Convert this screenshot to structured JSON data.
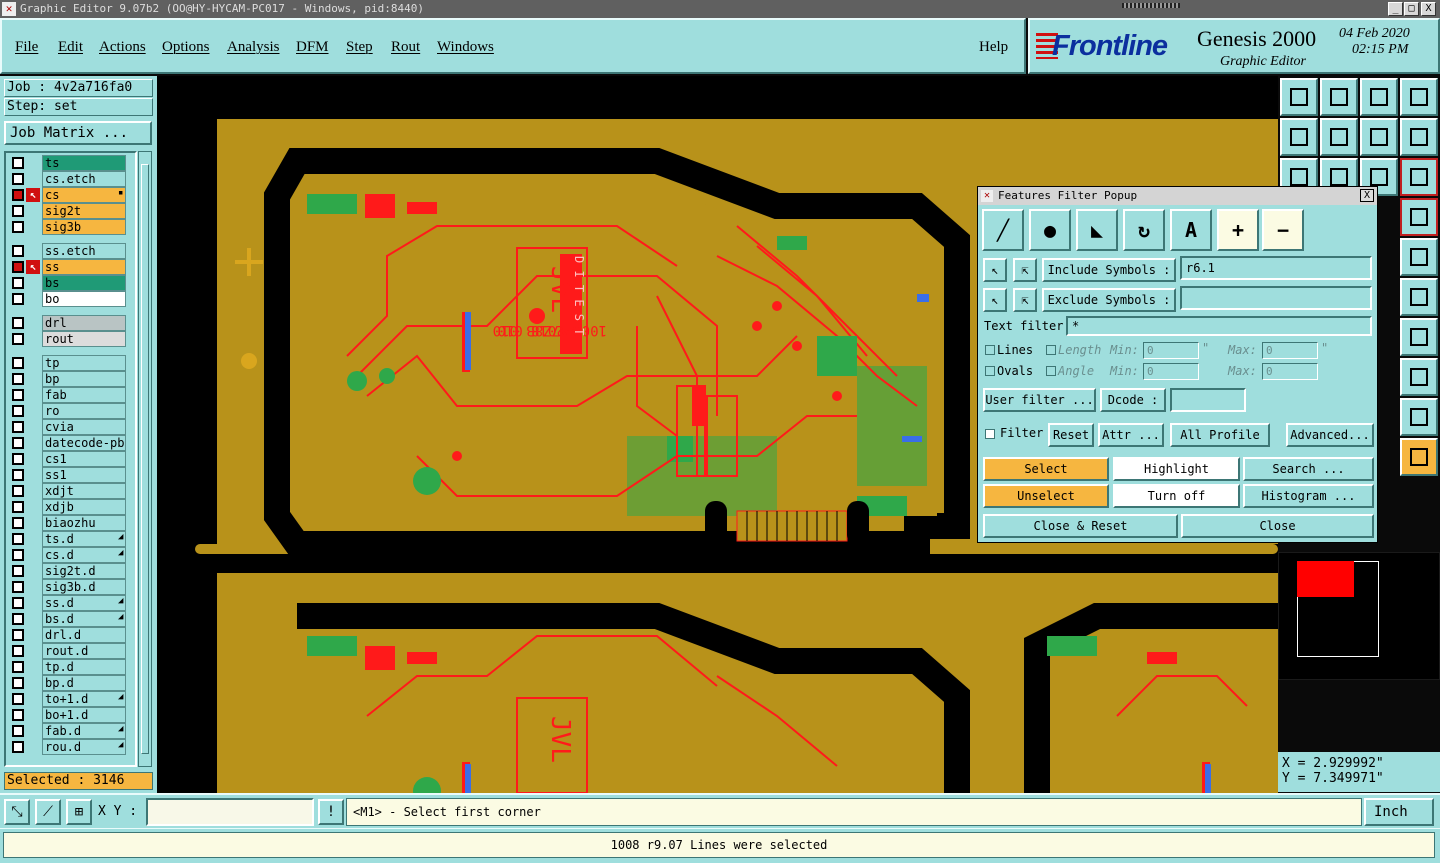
{
  "window": {
    "title": "Graphic Editor 9.07b2 (OO@HY-HYCAM-PC017 - Windows, pid:8440)",
    "minimize": "_",
    "maximize": "□",
    "close": "X"
  },
  "menu": [
    "File",
    "Edit",
    "Actions",
    "Options",
    "Analysis",
    "DFM",
    "Step",
    "Rout",
    "Windows"
  ],
  "help_label": "Help",
  "brand": {
    "logo": "Frontline",
    "product": "Genesis 2000",
    "subtitle": "Graphic Editor",
    "date": "04 Feb 2020",
    "time": "02:15 PM"
  },
  "job": {
    "job_label": "Job : 4v2a716fa0",
    "step_label": "Step: set",
    "matrix_button": "Job Matrix ..."
  },
  "layers": [
    {
      "name": "ts",
      "color": "#1f9a76",
      "active": false,
      "arrow": ""
    },
    {
      "name": "cs.etch",
      "color": "#9fdedd",
      "active": false,
      "arrow": ""
    },
    {
      "name": "cs",
      "color": "#f6b640",
      "active": true,
      "arrow": "↖",
      "mark": "▪"
    },
    {
      "name": "sig2t",
      "color": "#f6b640",
      "active": false,
      "arrow": ""
    },
    {
      "name": "sig3b",
      "color": "#f6b640",
      "active": false,
      "arrow": ""
    },
    {
      "name": "ss.etch",
      "color": "#9fdedd",
      "active": false,
      "arrow": ""
    },
    {
      "name": "ss",
      "color": "#f6b640",
      "active": true,
      "arrow": "↖"
    },
    {
      "name": "bs",
      "color": "#1f9a76",
      "active": false,
      "arrow": ""
    },
    {
      "name": "bo",
      "color": "#ffffff",
      "active": false,
      "arrow": ""
    },
    {
      "name": "drl",
      "color": "#b9c4c4",
      "active": false,
      "arrow": ""
    },
    {
      "name": "rout",
      "color": "#dcdcdc",
      "active": false,
      "arrow": ""
    },
    {
      "name": "tp",
      "color": "#9fdedd",
      "active": false,
      "arrow": ""
    },
    {
      "name": "bp",
      "color": "#9fdedd",
      "active": false,
      "arrow": ""
    },
    {
      "name": "fab",
      "color": "#9fdedd",
      "active": false,
      "arrow": ""
    },
    {
      "name": "ro",
      "color": "#9fdedd",
      "active": false,
      "arrow": ""
    },
    {
      "name": "cvia",
      "color": "#9fdedd",
      "active": false,
      "arrow": ""
    },
    {
      "name": "datecode-pbc",
      "color": "#9fdedd",
      "active": false,
      "arrow": ""
    },
    {
      "name": "cs1",
      "color": "#9fdedd",
      "active": false,
      "arrow": ""
    },
    {
      "name": "ss1",
      "color": "#9fdedd",
      "active": false,
      "arrow": ""
    },
    {
      "name": "xdjt",
      "color": "#9fdedd",
      "active": false,
      "arrow": ""
    },
    {
      "name": "xdjb",
      "color": "#9fdedd",
      "active": false,
      "arrow": ""
    },
    {
      "name": "biaozhu",
      "color": "#9fdedd",
      "active": false,
      "arrow": ""
    },
    {
      "name": "ts.d",
      "color": "#9fdedd",
      "active": false,
      "arrow": "",
      "mark": "◢"
    },
    {
      "name": "cs.d",
      "color": "#9fdedd",
      "active": false,
      "arrow": "",
      "mark": "◢"
    },
    {
      "name": "sig2t.d",
      "color": "#9fdedd",
      "active": false,
      "arrow": ""
    },
    {
      "name": "sig3b.d",
      "color": "#9fdedd",
      "active": false,
      "arrow": ""
    },
    {
      "name": "ss.d",
      "color": "#9fdedd",
      "active": false,
      "arrow": "",
      "mark": "◢"
    },
    {
      "name": "bs.d",
      "color": "#9fdedd",
      "active": false,
      "arrow": "",
      "mark": "◢"
    },
    {
      "name": "drl.d",
      "color": "#9fdedd",
      "active": false,
      "arrow": ""
    },
    {
      "name": "rout.d",
      "color": "#9fdedd",
      "active": false,
      "arrow": ""
    },
    {
      "name": "tp.d",
      "color": "#9fdedd",
      "active": false,
      "arrow": ""
    },
    {
      "name": "bp.d",
      "color": "#9fdedd",
      "active": false,
      "arrow": ""
    },
    {
      "name": "to+1.d",
      "color": "#9fdedd",
      "active": false,
      "arrow": "",
      "mark": "◢"
    },
    {
      "name": "bo+1.d",
      "color": "#9fdedd",
      "active": false,
      "arrow": ""
    },
    {
      "name": "fab.d",
      "color": "#9fdedd",
      "active": false,
      "arrow": "",
      "mark": "◢"
    },
    {
      "name": "rou.d",
      "color": "#9fdedd",
      "active": false,
      "arrow": "",
      "mark": "◢"
    }
  ],
  "selected_label": "Selected : 3146",
  "canvas_text": {
    "board_text_a": "JVL",
    "board_text_b": "2M7Z8B 010",
    "board_text_c": "1002-2018 010",
    "board_text_d": "D I T E S T"
  },
  "popup": {
    "title": "Features Filter Popup",
    "close": "X",
    "include_label": "Include Symbols :",
    "include_value": "r6.1",
    "exclude_label": "Exclude Symbols :",
    "exclude_value": "",
    "text_filter_label": "Text filter",
    "text_filter_value": "*",
    "lines_label": "Lines",
    "ovals_label": "Ovals",
    "length_label": "Length",
    "angle_label": "Angle",
    "min_label": "Min:",
    "max_label": "Max:",
    "quote": "\"",
    "zero": "0",
    "user_filter": "User filter ...",
    "dcode_label": "Dcode :",
    "filter_label": "Filter",
    "reset": "Reset",
    "attr": "Attr ...",
    "all_profile": "All Profile",
    "advanced": "Advanced...",
    "select": "Select",
    "highlight": "Highlight",
    "search": "Search ...",
    "unselect": "Unselect",
    "turn_off": "Turn off",
    "histogram": "Histogram ...",
    "close_reset": "Close & Reset",
    "close_btn": "Close",
    "plus": "+",
    "minus": "−",
    "text_tool": "A"
  },
  "coords": {
    "x": "X = 2.929992\"",
    "y": "Y = 7.349971\""
  },
  "bottom": {
    "xy_label": "X Y :",
    "xy_value": "",
    "warn": "!",
    "message": "<M1> - Select first corner",
    "unit": "Inch",
    "status": "1008 r9.07 Lines were selected"
  },
  "toolbar_icons": [
    "layer-up-icon",
    "layer-down-icon",
    "home-icon",
    "window-icon",
    "step-left-icon",
    "step-right-icon",
    "undo-icon",
    "redo-icon",
    "fit-icon",
    "center-icon",
    "scale-icon",
    "help-icon"
  ],
  "colors": {
    "panel": "#9fdedd",
    "board_copper": "#b8921a",
    "trace_red": "#ff1a1a",
    "green": "#2fa84a",
    "orange": "#f6b640"
  }
}
